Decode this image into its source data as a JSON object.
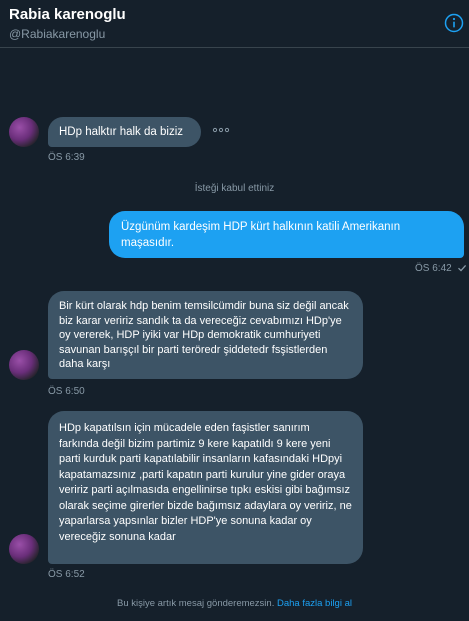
{
  "header": {
    "name": "Rabia karenoglu",
    "handle": "@Rabiakarenoglu",
    "info_icon": "info-icon"
  },
  "messages": [
    {
      "direction": "in",
      "text": "HDp halktır halk da biziz",
      "time": "ÖS 6:39"
    },
    {
      "direction": "system",
      "text": "İsteği kabul ettiniz"
    },
    {
      "direction": "out",
      "text": "Üzgünüm kardeşim HDP kürt halkının katili Amerikanın maşasıdır.",
      "time": "ÖS 6:42",
      "status_icon": "check-icon"
    },
    {
      "direction": "in",
      "text": "Bir kürt olarak hdp benim temsilcümdir buna siz değil ancak biz karar veririz sandık ta da vereceğiz cevabımızı HDp'ye oy vererek, HDP iyiki var HDp demokratik cumhuriyeti savunan barışçıl bir parti teröredr şiddetedr fsşistlerden daha karşı",
      "time": "ÖS 6:50"
    },
    {
      "direction": "in",
      "text": "HDp kapatılsın için mücadele eden faşistler sanırım farkında değil bizim partimiz 9 kere kapatıldı 9 kere yeni parti kurduk parti kapatılabilir insanların kafasındaki HDpyi kapatamazsınız ,parti kapatın parti kurulur yine gider oraya veririz parti açılmasıda engellinirse tıpkı eskisi gibi bağımsız olarak seçime girerler bizde bağımsız adaylara oy veririz, ne yaparlarsa yapsınlar bizler HDP'ye sonuna kadar oy vereceğiz sonuna kadar",
      "time": "ÖS 6:52"
    }
  ],
  "footer": {
    "notice": "Bu kişiye artık mesaj gönderemezsin.",
    "link": "Daha fazla bilgi al"
  },
  "colors": {
    "background": "#15202b",
    "incoming_bubble": "#3d5466",
    "outgoing_bubble": "#1da1f2",
    "muted_text": "#8899a6"
  }
}
